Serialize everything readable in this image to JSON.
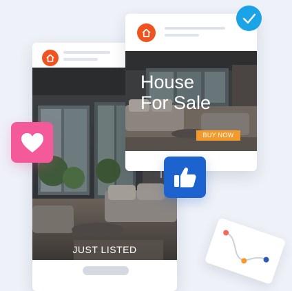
{
  "listing_card": {
    "banner_text": "JUST LISTED"
  },
  "sale_card": {
    "headline": "House\nFor Sale",
    "button_label": "BUY NOW",
    "button_color": "#f49a2a"
  },
  "badges": {
    "check_color": "#1aa3e6",
    "heart_color": "#f45a9a",
    "like_color": "#1d63cf"
  },
  "brand_logo_color": "#f0531f",
  "icons": [
    "house-logo-icon",
    "checkmark-icon",
    "heart-icon",
    "thumbs-up-icon",
    "chevron-up-icon",
    "mini-line-chart"
  ]
}
